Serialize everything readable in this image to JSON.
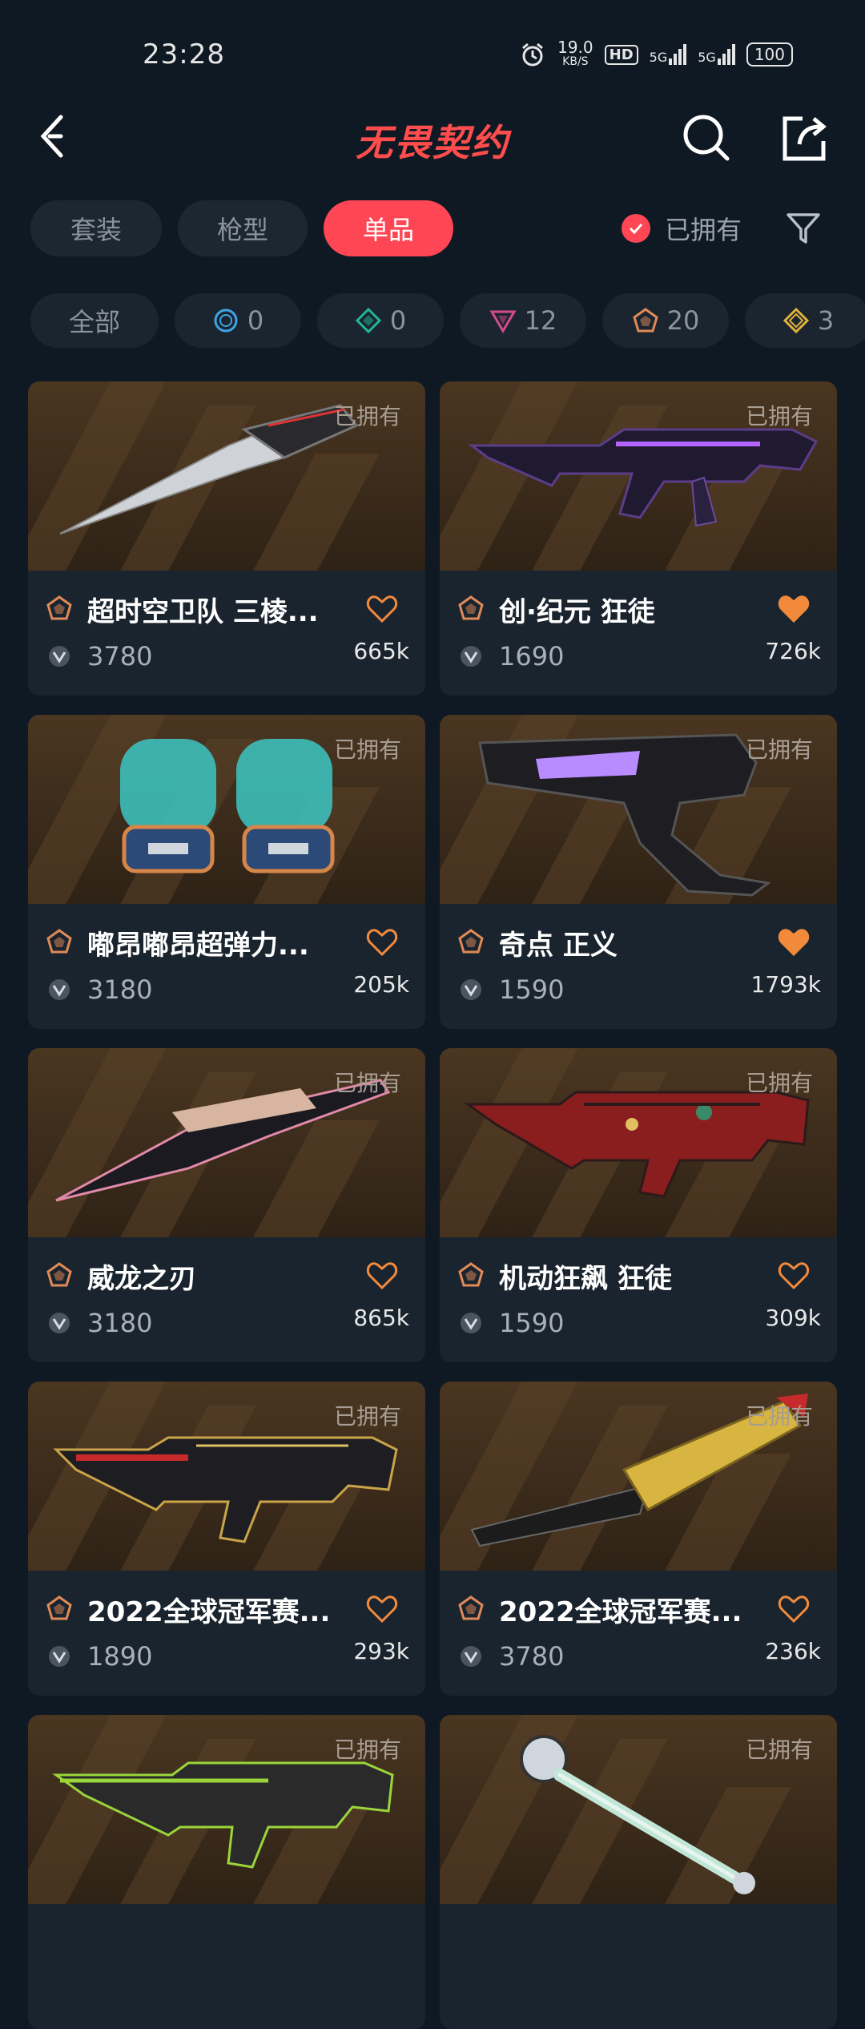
{
  "status_bar": {
    "time": "23:28",
    "net_speed": "19.0",
    "net_unit": "KB/S",
    "hd": "HD",
    "signal1": "5G",
    "signal2": "5G",
    "battery": "100"
  },
  "header": {
    "title": "无畏契约"
  },
  "tabs": [
    {
      "label": "套装",
      "active": false
    },
    {
      "label": "枪型",
      "active": false
    },
    {
      "label": "单品",
      "active": true
    }
  ],
  "owned_filter_label": "已拥有",
  "rarity_chips": [
    {
      "label": "全部"
    },
    {
      "label": "0",
      "color": "#3fa4e6"
    },
    {
      "label": "0",
      "color": "#22b59a"
    },
    {
      "label": "12",
      "color": "#d44a8e"
    },
    {
      "label": "20",
      "color": "#e08a57"
    },
    {
      "label": "3",
      "color": "#e0b23a"
    }
  ],
  "owned_tag": "已拥有",
  "items": [
    {
      "name": "超时空卫队 三棱...",
      "price": "3780",
      "likes": "665k",
      "liked": false
    },
    {
      "name": "创·纪元 狂徒",
      "price": "1690",
      "likes": "726k",
      "liked": true
    },
    {
      "name": "嘟昂嘟昂超弹力...",
      "price": "3180",
      "likes": "205k",
      "liked": false
    },
    {
      "name": "奇点 正义",
      "price": "1590",
      "likes": "1793k",
      "liked": true
    },
    {
      "name": "威龙之刃",
      "price": "3180",
      "likes": "865k",
      "liked": false
    },
    {
      "name": "机动狂飙 狂徒",
      "price": "1590",
      "likes": "309k",
      "liked": false
    },
    {
      "name": "2022全球冠军赛...",
      "price": "1890",
      "likes": "293k",
      "liked": false
    },
    {
      "name": "2022全球冠军赛...",
      "price": "3780",
      "likes": "236k",
      "liked": false
    },
    {
      "name": "",
      "price": "",
      "likes": "",
      "liked": false
    },
    {
      "name": "",
      "price": "",
      "likes": "",
      "liked": false
    }
  ],
  "colors": {
    "accent": "#ff4655",
    "heart": "#f28a3c",
    "background": "#0f1923"
  }
}
